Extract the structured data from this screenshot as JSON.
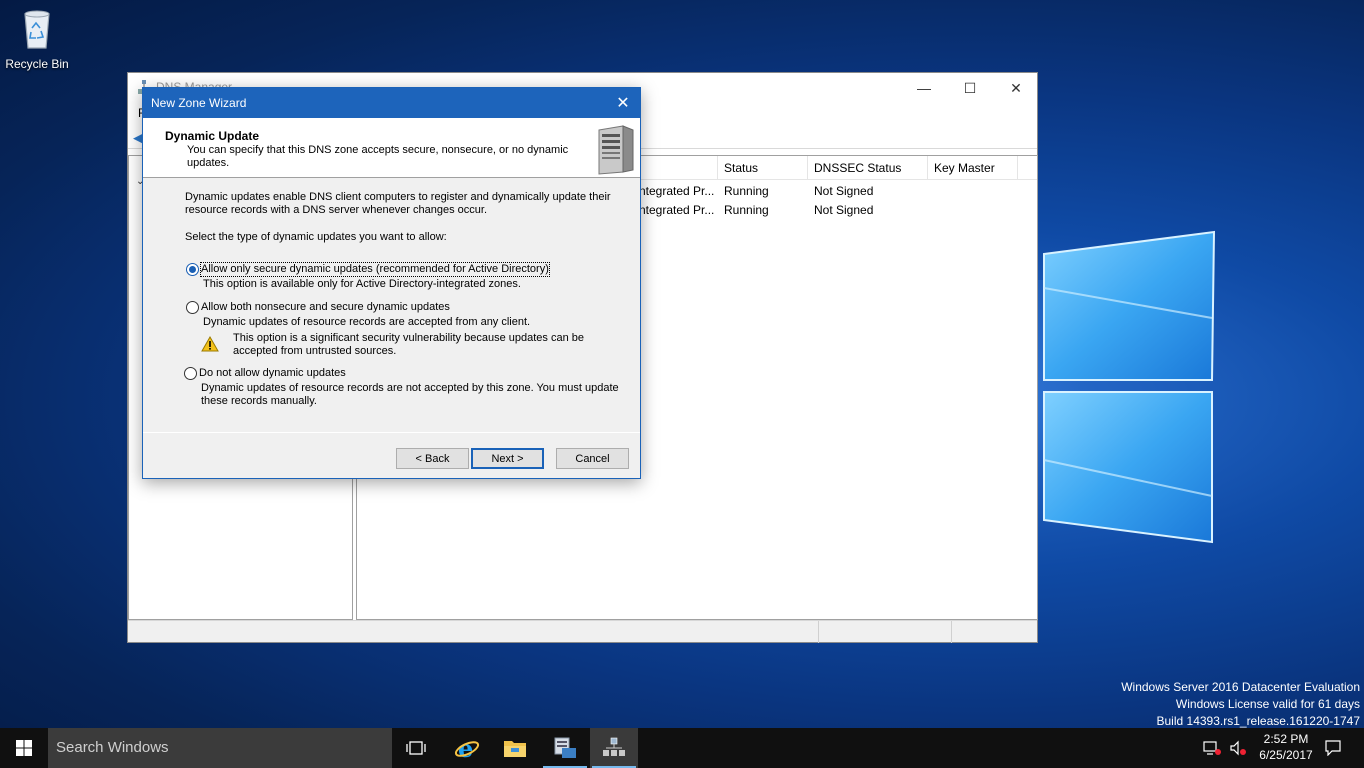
{
  "desktop": {
    "recycle_bin_label": "Recycle Bin",
    "watermark": {
      "line1": "Windows Server 2016 Datacenter Evaluation",
      "line2": "Windows License valid for 61 days",
      "line3": "Build 14393.rs1_release.161220-1747"
    }
  },
  "dns_manager": {
    "title": "DNS Manager",
    "menu_first": "F",
    "columns": [
      "Status",
      "DNSSEC Status",
      "Key Master"
    ],
    "rows": [
      {
        "type": "ntegrated Pr...",
        "status": "Running",
        "dnssec": "Not Signed"
      },
      {
        "type": "ntegrated Pr...",
        "status": "Running",
        "dnssec": "Not Signed"
      }
    ]
  },
  "wizard": {
    "title": "New Zone Wizard",
    "header_title": "Dynamic Update",
    "header_subtitle": "You can specify that this DNS zone accepts secure, nonsecure, or no dynamic updates.",
    "intro": "Dynamic updates enable DNS client computers to register and dynamically update their resource records with a DNS server whenever changes occur.",
    "prompt": "Select the type of dynamic updates you want to allow:",
    "options": [
      {
        "label": "Allow only secure dynamic updates (recommended for Active Directory)",
        "description": "This option is available only for Active Directory-integrated zones.",
        "selected": true
      },
      {
        "label": "Allow both nonsecure and secure dynamic updates",
        "description": "Dynamic updates of resource records are accepted from any client.",
        "warning": "This option is a significant security vulnerability because updates can be accepted from untrusted sources.",
        "selected": false
      },
      {
        "label": "Do not allow dynamic updates",
        "description": "Dynamic updates of resource records are not accepted by this zone. You must update these records manually.",
        "selected": false
      }
    ],
    "buttons": {
      "back": "< Back",
      "next": "Next >",
      "cancel": "Cancel"
    }
  },
  "taskbar": {
    "search_placeholder": "Search Windows",
    "clock_time": "2:52 PM",
    "clock_date": "6/25/2017"
  },
  "colors": {
    "accent": "#1d64bb",
    "taskbar": "#101010"
  }
}
